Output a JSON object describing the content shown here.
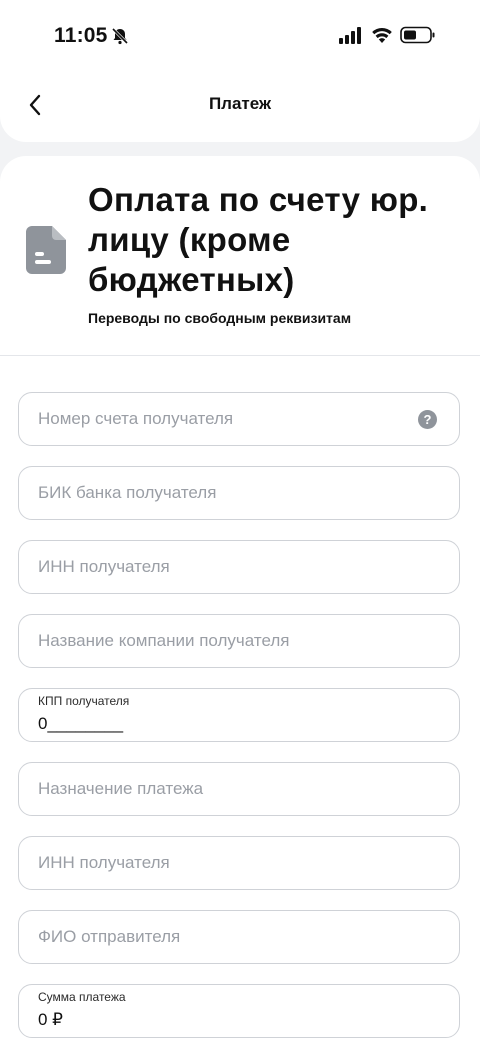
{
  "status_bar": {
    "time": "11:05"
  },
  "header": {
    "title": "Платеж"
  },
  "main": {
    "title": "Оплата по счету юр. лицу (кроме бюджетных)",
    "subtitle": "Переводы по свободным реквизитам",
    "icon": "document-icon",
    "fields": [
      {
        "placeholder": "Номер счета получателя",
        "has_help": true
      },
      {
        "placeholder": "БИК банка получателя"
      },
      {
        "placeholder": "ИНН получателя"
      },
      {
        "placeholder": "Название компании получателя"
      },
      {
        "label": "КПП получателя",
        "value": "0________"
      },
      {
        "placeholder": "Назначение платежа"
      },
      {
        "placeholder": "ИНН получателя"
      },
      {
        "placeholder": "ФИО отправителя"
      },
      {
        "label": "Сумма платежа",
        "value": "0 ₽"
      }
    ],
    "help_glyph": "?"
  },
  "colors": {
    "background": "#f2f3f5",
    "surface": "#ffffff",
    "placeholder": "#9a9ea5",
    "border": "#cfd2d7",
    "icon_gray": "#8f949b"
  }
}
